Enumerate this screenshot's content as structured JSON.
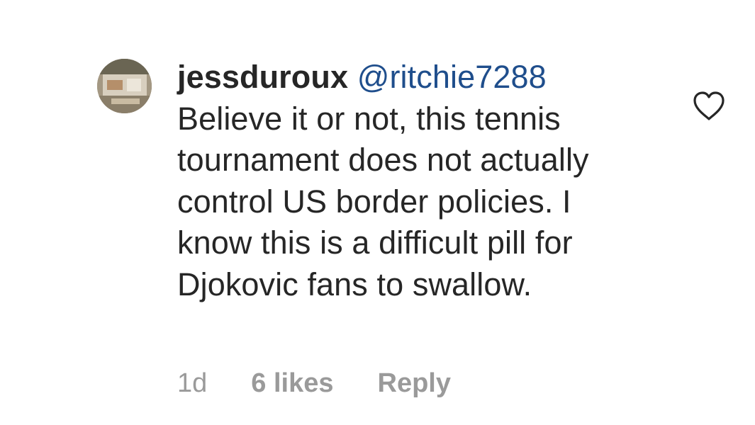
{
  "comment": {
    "username": "jessduroux",
    "mention": "@ritchie7288",
    "text": "Believe it or not, this tennis tournament does not actually control US border policies. I know this is a difficult pill for Djokovic fans to swallow.",
    "time": "1d",
    "likes": "6 likes",
    "reply_label": "Reply",
    "like_icon": "heart-outline-icon",
    "avatar_icon": "user-avatar"
  },
  "colors": {
    "text": "#262626",
    "mention": "#1f4e8c",
    "meta": "#9a9a9a"
  }
}
